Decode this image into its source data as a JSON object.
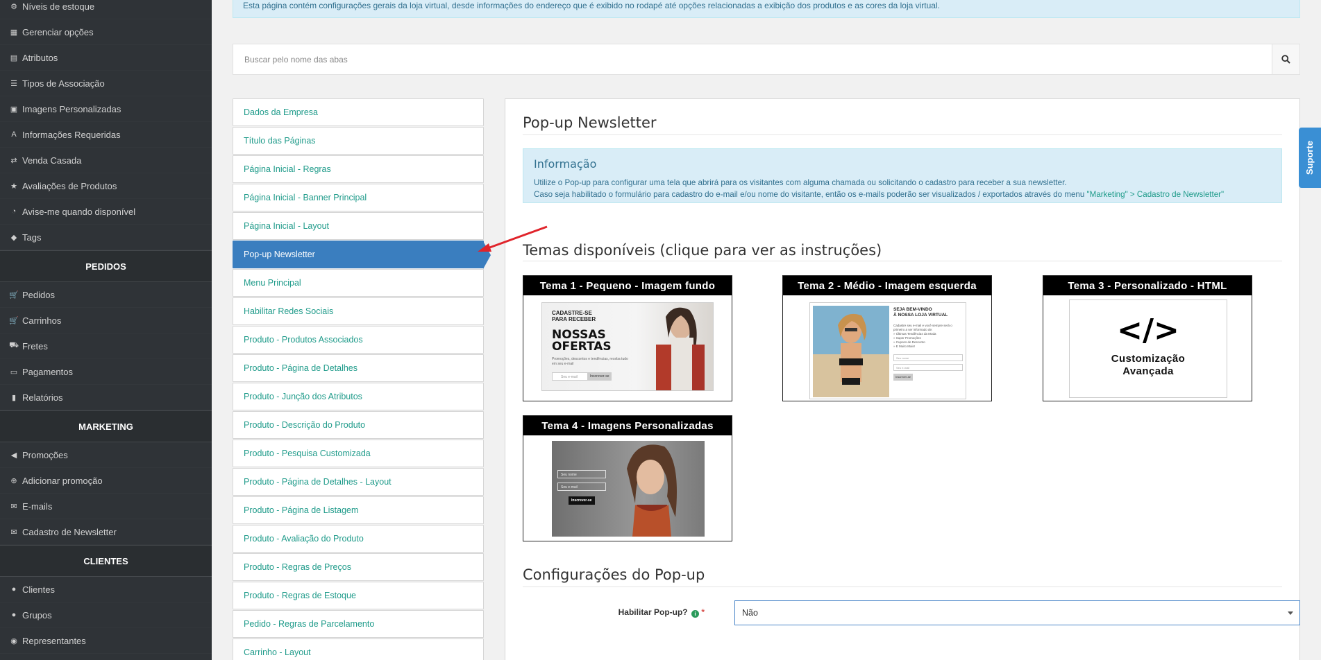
{
  "sidebar": {
    "items_top": [
      {
        "label": "Níveis de estoque",
        "icon": "cubes-icon"
      },
      {
        "label": "Gerenciar opções",
        "icon": "grid-icon"
      },
      {
        "label": "Atributos",
        "icon": "list-icon"
      },
      {
        "label": "Tipos de Associação",
        "icon": "list-alt-icon"
      },
      {
        "label": "Imagens Personalizadas",
        "icon": "image-icon"
      },
      {
        "label": "Informações Requeridas",
        "icon": "font-icon"
      },
      {
        "label": "Venda Casada",
        "icon": "shuffle-icon"
      },
      {
        "label": "Avaliações de Produtos",
        "icon": "star-icon"
      },
      {
        "label": "Avise-me quando disponível",
        "icon": "clock-icon"
      },
      {
        "label": "Tags",
        "icon": "tag-icon"
      }
    ],
    "section_pedidos": "PEDIDOS",
    "items_pedidos": [
      {
        "label": "Pedidos",
        "icon": "cart-icon"
      },
      {
        "label": "Carrinhos",
        "icon": "cart-icon"
      },
      {
        "label": "Fretes",
        "icon": "truck-icon"
      },
      {
        "label": "Pagamentos",
        "icon": "credit-card-icon"
      },
      {
        "label": "Relatórios",
        "icon": "bar-chart-icon"
      }
    ],
    "section_marketing": "MARKETING",
    "items_marketing": [
      {
        "label": "Promoções",
        "icon": "bullhorn-icon"
      },
      {
        "label": "Adicionar promoção",
        "icon": "plus-circle-icon"
      },
      {
        "label": "E-mails",
        "icon": "envelope-icon"
      },
      {
        "label": "Cadastro de Newsletter",
        "icon": "envelope-icon"
      }
    ],
    "section_clientes": "CLIENTES",
    "items_clientes": [
      {
        "label": "Clientes",
        "icon": "user-icon"
      },
      {
        "label": "Grupos",
        "icon": "users-icon"
      },
      {
        "label": "Representantes",
        "icon": "user-circle-icon"
      }
    ]
  },
  "top_info": "Esta página contém configurações gerais da loja virtual, desde informações do endereço que é exibido no rodapé até opções relacionadas a exibição dos produtos e as cores da loja virtual.",
  "search": {
    "placeholder": "Buscar pelo nome das abas"
  },
  "tabs": [
    {
      "label": "Dados da Empresa",
      "active": false
    },
    {
      "label": "Título das Páginas",
      "active": false
    },
    {
      "label": "Página Inicial - Regras",
      "active": false
    },
    {
      "label": "Página Inicial - Banner Principal",
      "active": false
    },
    {
      "label": "Página Inicial - Layout",
      "active": false
    },
    {
      "label": "Pop-up Newsletter",
      "active": true
    },
    {
      "label": "Menu Principal",
      "active": false
    },
    {
      "label": "Habilitar Redes Sociais",
      "active": false
    },
    {
      "label": "Produto - Produtos Associados",
      "active": false
    },
    {
      "label": "Produto - Página de Detalhes",
      "active": false
    },
    {
      "label": "Produto - Junção dos Atributos",
      "active": false
    },
    {
      "label": "Produto - Descrição do Produto",
      "active": false
    },
    {
      "label": "Produto - Pesquisa Customizada",
      "active": false
    },
    {
      "label": "Produto - Página de Detalhes - Layout",
      "active": false
    },
    {
      "label": "Produto - Página de Listagem",
      "active": false
    },
    {
      "label": "Produto - Avaliação do Produto",
      "active": false
    },
    {
      "label": "Produto - Regras de Preços",
      "active": false
    },
    {
      "label": "Produto - Regras de Estoque",
      "active": false
    },
    {
      "label": "Pedido - Regras de Parcelamento",
      "active": false
    },
    {
      "label": "Carrinho - Layout",
      "active": false
    }
  ],
  "panel": {
    "title": "Pop-up Newsletter",
    "info_title": "Informação",
    "info_line1": "Utilize o Pop-up para configurar uma tela que abrirá para os visitantes com alguma chamada ou solicitando o cadastro para receber a sua newsletter.",
    "info_line2_prefix": "Caso seja habilitado o formulário para cadastro do e-mail e/ou nome do visitante, então os e-mails poderão ser visualizados / exportados através do menu ",
    "info_line2_link": "\"Marketing\" > Cadastro de Newsletter\"",
    "themes_title": "Temas disponíveis (clique para ver as instruções)",
    "themes": [
      {
        "title": "Tema 1 - Pequeno - Imagem fundo",
        "thumb_line1": "CADASTRE-SE",
        "thumb_line2": "PARA RECEBER",
        "thumb_big1": "NOSSAS",
        "thumb_big2": "OFERTAS",
        "thumb_small": "Promoções, descontos e tendências, receba tudo em seu e-mail",
        "thumb_input": "Seu e-mail",
        "thumb_button": "Inscrever-se"
      },
      {
        "title": "Tema 2 - Médio - Imagem esquerda",
        "thumb_line1": "SEJA BEM-VINDO",
        "thumb_line2": "À NOSSA LOJA VIRTUAL",
        "thumb_body": "Cadastre seu e-mail e você sempre será o primeiro a ser informado de:",
        "thumb_bullets": [
          "» Últimas Tendências da Moda",
          "» Super Promoções",
          "» Cupons de Desconto",
          "» E Muito Mais!"
        ],
        "thumb_input1": "Seu nome",
        "thumb_input2": "Seu e-mail",
        "thumb_button": "Inscrever-se"
      },
      {
        "title": "Tema 3 - Personalizado - HTML",
        "code_symbol": "</>",
        "caption1": "Customização",
        "caption2": "Avançada"
      },
      {
        "title": "Tema 4 - Imagens Personalizadas",
        "thumb_input1": "Seu nome",
        "thumb_input2": "Seu e-mail",
        "thumb_button": "Inscrever-se"
      }
    ],
    "config_title": "Configurações do Pop-up",
    "field_label": "Habilitar Pop-up?",
    "field_value": "Não",
    "required_mark": "*"
  },
  "support_label": "Suporte",
  "colors": {
    "sidebar_bg": "#2f3337",
    "accent": "#3a7ebf",
    "link": "#1f9b8a",
    "info_bg": "#d9edf7",
    "arrow": "#e0242b"
  }
}
